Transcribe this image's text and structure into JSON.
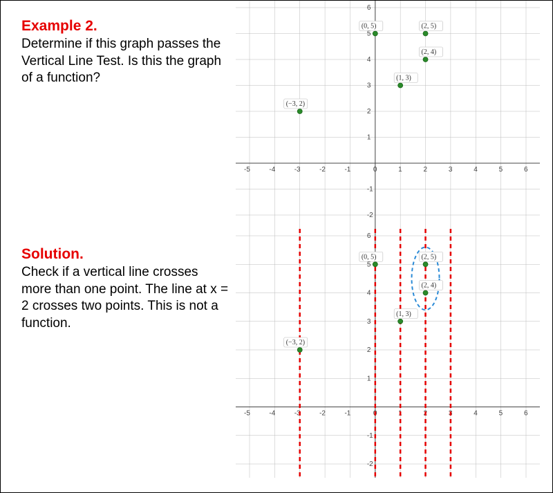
{
  "example": {
    "heading": "Example 2.",
    "text": "Determine if this graph passes the Vertical Line Test. Is this the graph of a function?"
  },
  "solution": {
    "heading": "Solution.",
    "text": "Check if a vertical line crosses more than one point. The line at x = 2 crosses two points. This is not a function."
  },
  "chart_data": [
    {
      "type": "scatter",
      "title": "",
      "xlabel": "",
      "ylabel": "",
      "xlim": [
        -5,
        6
      ],
      "ylim": [
        -2,
        6
      ],
      "xticks": [
        -5,
        -4,
        -3,
        -2,
        -1,
        0,
        1,
        2,
        3,
        4,
        5,
        6
      ],
      "yticks": [
        -2,
        -1,
        1,
        2,
        3,
        4,
        5,
        6
      ],
      "points": [
        {
          "x": -3,
          "y": 2,
          "label": "(−3, 2)"
        },
        {
          "x": 0,
          "y": 5,
          "label": "(0, 5)"
        },
        {
          "x": 1,
          "y": 3,
          "label": "(1, 3)"
        },
        {
          "x": 2,
          "y": 4,
          "label": "(2, 4)"
        },
        {
          "x": 2,
          "y": 5,
          "label": "(2, 5)"
        }
      ]
    },
    {
      "type": "scatter",
      "title": "",
      "xlabel": "",
      "ylabel": "",
      "xlim": [
        -5,
        6
      ],
      "ylim": [
        -2,
        6
      ],
      "xticks": [
        -5,
        -4,
        -3,
        -2,
        -1,
        0,
        1,
        2,
        3,
        4,
        5,
        6
      ],
      "yticks": [
        -2,
        -1,
        1,
        2,
        3,
        4,
        5,
        6
      ],
      "points": [
        {
          "x": -3,
          "y": 2,
          "label": "(−3, 2)"
        },
        {
          "x": 0,
          "y": 5,
          "label": "(0, 5)"
        },
        {
          "x": 1,
          "y": 3,
          "label": "(1, 3)"
        },
        {
          "x": 2,
          "y": 4,
          "label": "(2, 4)"
        },
        {
          "x": 2,
          "y": 5,
          "label": "(2, 5)"
        }
      ],
      "vertical_lines_x": [
        -3,
        0,
        1,
        2,
        3
      ],
      "highlight_ellipse": {
        "cx": 2,
        "cy": 4.5,
        "rx": 0.55,
        "ry": 1.1
      }
    }
  ]
}
